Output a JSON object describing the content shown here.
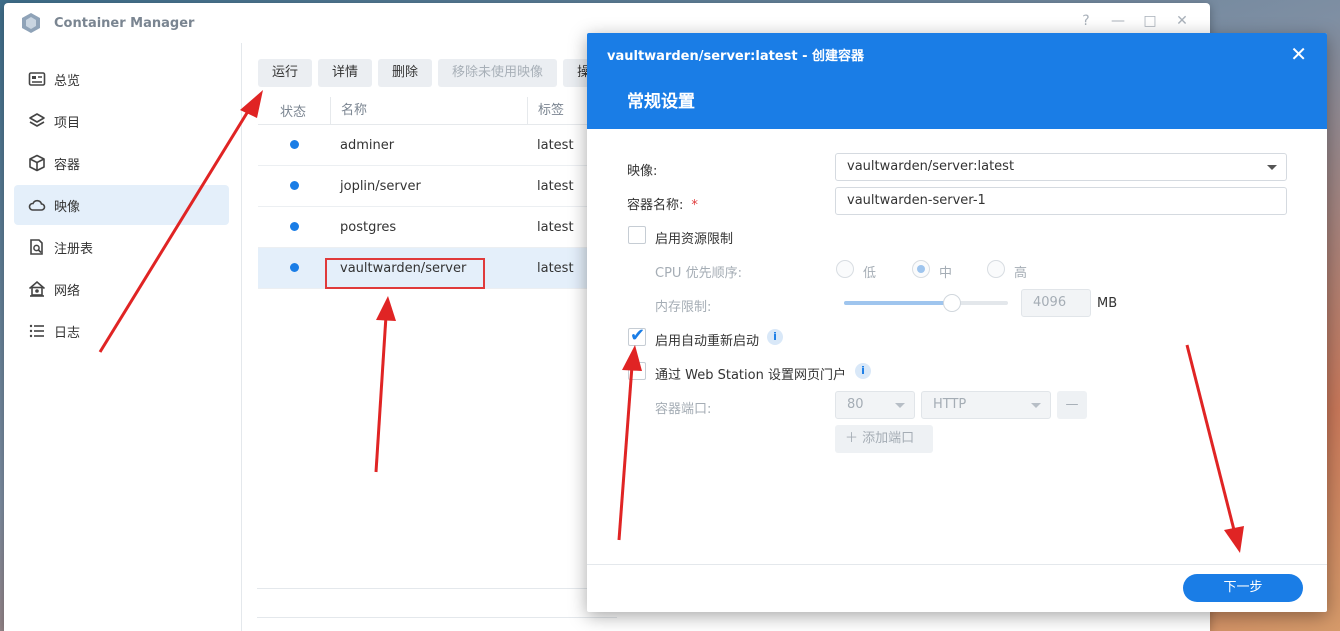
{
  "app": {
    "title": "Container Manager"
  },
  "window_controls": {
    "help": "?",
    "minimize": "—",
    "maximize": "□",
    "close": "✕"
  },
  "sidebar": {
    "items": [
      {
        "label": "总览",
        "icon": "overview-icon"
      },
      {
        "label": "项目",
        "icon": "layers-icon"
      },
      {
        "label": "容器",
        "icon": "cube-icon"
      },
      {
        "label": "映像",
        "icon": "cloud-icon",
        "active": true
      },
      {
        "label": "注册表",
        "icon": "registry-icon"
      },
      {
        "label": "网络",
        "icon": "network-icon"
      },
      {
        "label": "日志",
        "icon": "list-icon"
      }
    ]
  },
  "toolbar": {
    "run": "运行",
    "details": "详情",
    "delete": "删除",
    "remove_unused": "移除未使用映像",
    "more": "操"
  },
  "grid": {
    "columns": {
      "status": "状态",
      "name": "名称",
      "tag": "标签"
    },
    "rows": [
      {
        "name": "adminer",
        "tag": "latest"
      },
      {
        "name": "joplin/server",
        "tag": "latest"
      },
      {
        "name": "postgres",
        "tag": "latest"
      },
      {
        "name": "vaultwarden/server",
        "tag": "latest",
        "selected": true
      }
    ]
  },
  "dialog": {
    "title": "vaultwarden/server:latest - 创建容器",
    "section": "常规设置",
    "image_label": "映像:",
    "image_value": "vaultwarden/server:latest",
    "name_label": "容器名称:",
    "required_mark": "*",
    "name_value": "vaultwarden-server-1",
    "resource_limit_label": "启用资源限制",
    "cpu_label": "CPU 优先顺序:",
    "cpu_options": [
      "低",
      "中",
      "高"
    ],
    "cpu_selected": "中",
    "memory_label": "内存限制:",
    "memory_value": "4096",
    "memory_unit": "MB",
    "memory_fraction": 0.66,
    "auto_restart_label": "启用自动重新启动",
    "auto_restart_checked": true,
    "web_station_label": "通过 Web Station 设置网页门户",
    "port_label": "容器端口:",
    "port_value": "80",
    "protocol_value": "HTTP",
    "minus_label": "—",
    "add_port_label": "添加端口",
    "next_button": "下一步",
    "close": "✕",
    "info": "i"
  },
  "colors": {
    "accent": "#1a7de6",
    "annotation": "#e03a3a",
    "selected_row": "#e4effa"
  }
}
